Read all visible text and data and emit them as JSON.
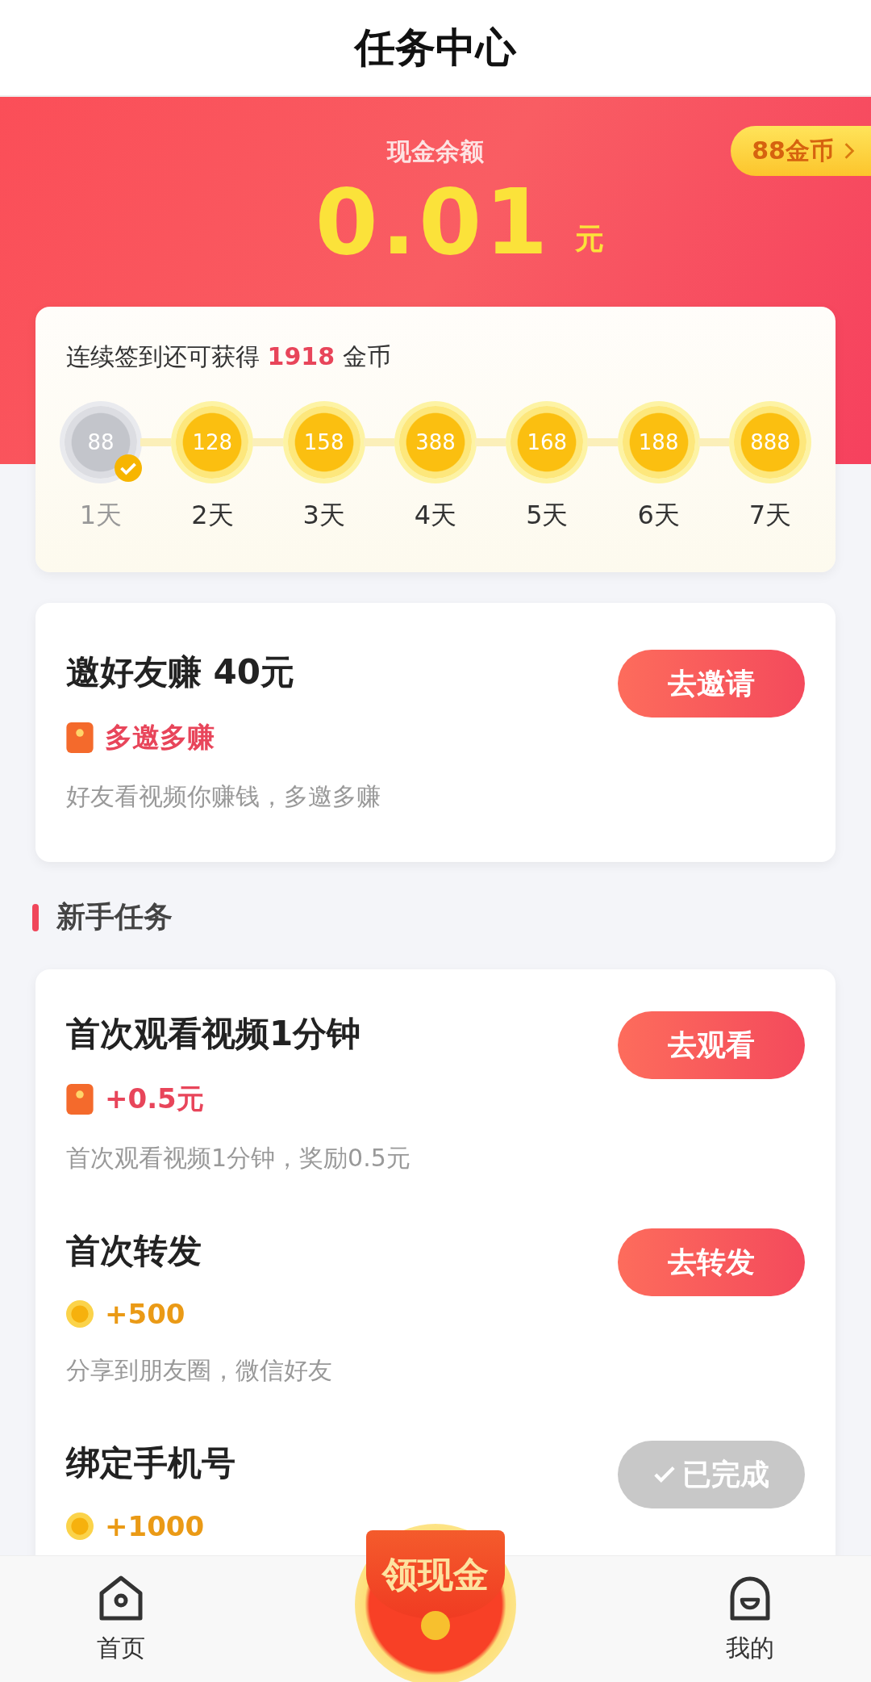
{
  "header": {
    "title": "任务中心"
  },
  "balance": {
    "label": "现金余额",
    "amount": "0.01",
    "unit": "元",
    "coins_badge": "88金币"
  },
  "signin": {
    "text": "连续签到还可获得 **1918** 金币",
    "days": [
      {
        "coins": "88",
        "label": "1天",
        "checked": true
      },
      {
        "coins": "128",
        "label": "2天",
        "checked": false
      },
      {
        "coins": "158",
        "label": "3天",
        "checked": false
      },
      {
        "coins": "388",
        "label": "4天",
        "checked": false
      },
      {
        "coins": "168",
        "label": "5天",
        "checked": false
      },
      {
        "coins": "188",
        "label": "6天",
        "checked": false
      },
      {
        "coins": "888",
        "label": "7天",
        "checked": false
      }
    ]
  },
  "invite": {
    "title": "邀好友赚 40元",
    "button": "去邀请",
    "reward": {
      "kind": "cash",
      "text": "多邀多赚"
    },
    "description": "好友看视频你赚钱，多邀多赚"
  },
  "section": {
    "title": "新手任务"
  },
  "tasks": [
    {
      "title": "首次观看视频1分钟",
      "reward": {
        "kind": "cash",
        "text": "+0.5元"
      },
      "description": "首次观看视频1分钟，奖励0.5元",
      "button": "去观看",
      "done": false
    },
    {
      "title": "首次转发",
      "reward": {
        "kind": "coin",
        "text": "+500"
      },
      "description": "分享到朋友圈，微信好友",
      "button": "去转发",
      "done": false
    },
    {
      "title": "绑定手机号",
      "reward": {
        "kind": "coin",
        "text": "+1000"
      },
      "button": "已完成",
      "done": true
    }
  ],
  "nav": {
    "items": [
      {
        "label": "首页",
        "kind": "home"
      },
      {
        "kind": "center",
        "label": "领现金"
      },
      {
        "label": "我的",
        "kind": "profile"
      }
    ]
  }
}
